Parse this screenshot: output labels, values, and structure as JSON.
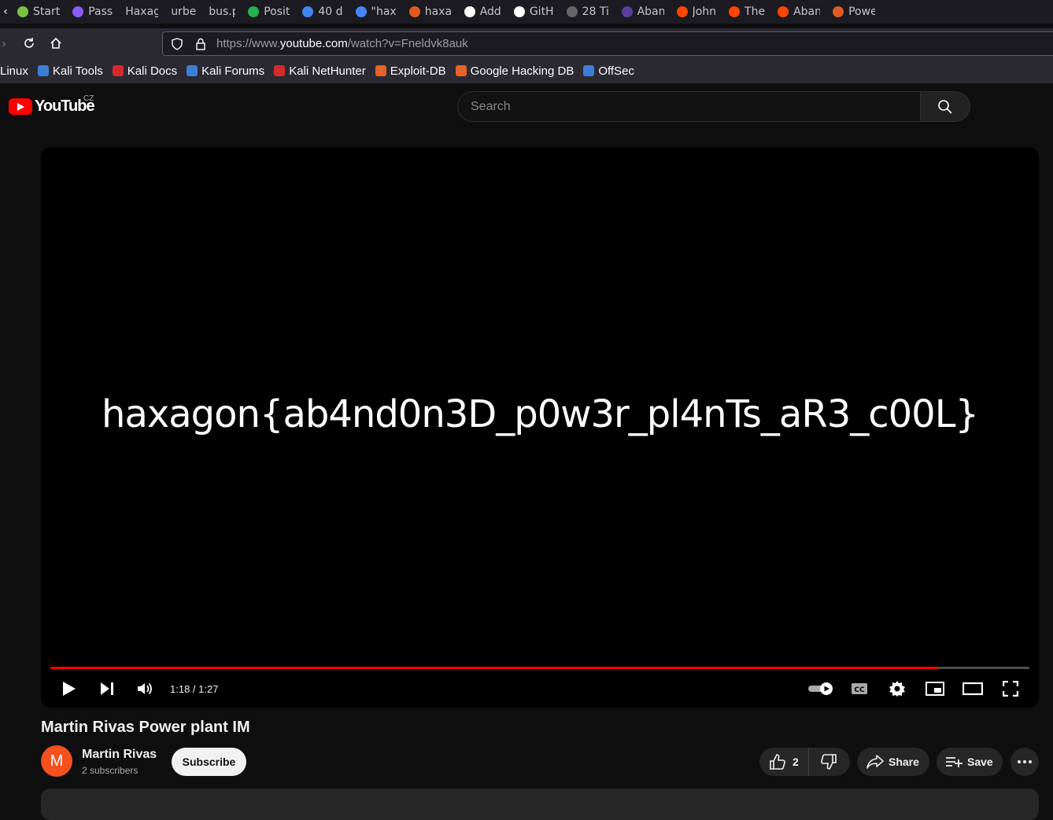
{
  "browser": {
    "tabs": [
      {
        "label": "Start",
        "color": "#7cc242"
      },
      {
        "label": "Pass",
        "color": "#8a5cf6"
      },
      {
        "label": "Haxagon",
        "color": ""
      },
      {
        "label": "urbex.jp",
        "color": ""
      },
      {
        "label": "bus.png",
        "color": ""
      },
      {
        "label": "Posit",
        "color": "#22b14c"
      },
      {
        "label": "40 d",
        "color": "#4285f4"
      },
      {
        "label": "\"hax",
        "color": "#4285f4"
      },
      {
        "label": "haxa",
        "color": "#e25b24"
      },
      {
        "label": "Add",
        "color": "#ffffff"
      },
      {
        "label": "GitH",
        "color": "#ffffff"
      },
      {
        "label": "28 Ti",
        "color": "#666666"
      },
      {
        "label": "Aban",
        "color": "#5a3fa0"
      },
      {
        "label": "John",
        "color": "#ff4500"
      },
      {
        "label": "The",
        "color": "#ff4500"
      },
      {
        "label": "Aban",
        "color": "#ff4500"
      },
      {
        "label": "Powe",
        "color": "#e25b24"
      }
    ],
    "url_scheme": "https://www.",
    "url_host": "youtube.com",
    "url_path": "/watch?v=Fneldvk8auk",
    "bookmarks": [
      {
        "label": "Linux",
        "color": ""
      },
      {
        "label": "Kali Tools",
        "color": "#3d7fd8"
      },
      {
        "label": "Kali Docs",
        "color": "#d62b2b"
      },
      {
        "label": "Kali Forums",
        "color": "#3d7fd8"
      },
      {
        "label": "Kali NetHunter",
        "color": "#d62b2b"
      },
      {
        "label": "Exploit-DB",
        "color": "#e8622b"
      },
      {
        "label": "Google Hacking DB",
        "color": "#e8622b"
      },
      {
        "label": "OffSec",
        "color": "#3d7fd8"
      }
    ]
  },
  "youtube": {
    "logo_text": "YouTube",
    "country_code": "CZ",
    "search_placeholder": "Search"
  },
  "player": {
    "video_text": "haxagon{ab4nd0n3D_p0w3r_pl4nTs_aR3_c00L}",
    "time_display": "1:18 / 1:27",
    "progress": 0.907
  },
  "video": {
    "title": "Martin Rivas Power plant IM",
    "channel_initial": "M",
    "channel_name": "Martin Rivas",
    "subscribers": "2 subscribers",
    "subscribe_label": "Subscribe",
    "like_count": "2",
    "share_label": "Share",
    "save_label": "Save"
  }
}
